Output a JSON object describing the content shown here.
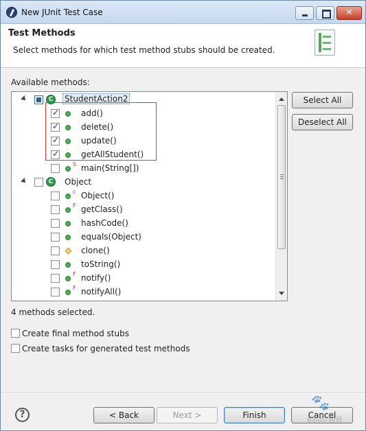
{
  "window": {
    "title": "New JUnit Test Case"
  },
  "header": {
    "title": "Test Methods",
    "description": "Select methods for which test method stubs should be created."
  },
  "available_label": "Available methods:",
  "tree": [
    {
      "label": "StudentAction2",
      "type": "class",
      "icon_letter": "C",
      "checked": "partial"
    },
    {
      "label": "add()",
      "type": "method",
      "checked": true
    },
    {
      "label": "delete()",
      "type": "method",
      "checked": true
    },
    {
      "label": "update()",
      "type": "method",
      "checked": true
    },
    {
      "label": "getAllStudent()",
      "type": "method",
      "checked": true
    },
    {
      "label": "main(String[])",
      "type": "method",
      "modifier": "S",
      "checked": false
    },
    {
      "label": "Object",
      "type": "class",
      "icon_letter": "C",
      "checked": false
    },
    {
      "label": "Object()",
      "type": "method",
      "modifier": "c",
      "checked": false
    },
    {
      "label": "getClass()",
      "type": "method",
      "modifier": "F",
      "checked": false
    },
    {
      "label": "hashCode()",
      "type": "method",
      "checked": false
    },
    {
      "label": "equals(Object)",
      "type": "method",
      "checked": false
    },
    {
      "label": "clone()",
      "type": "protected",
      "checked": false
    },
    {
      "label": "toString()",
      "type": "method",
      "checked": false
    },
    {
      "label": "notify()",
      "type": "method",
      "modifier": "F",
      "checked": false
    },
    {
      "label": "notifyAll()",
      "type": "method",
      "modifier": "F",
      "checked": false
    }
  ],
  "buttons": {
    "select_all": "Select All",
    "deselect_all": "Deselect All",
    "back": "< Back",
    "next": "Next >",
    "finish": "Finish",
    "cancel": "Cancel"
  },
  "status": "4 methods selected.",
  "options": {
    "final_stubs": "Create final method stubs",
    "tasks": "Create tasks for generated test methods"
  },
  "help": "?",
  "colors": {
    "method_green": "#4caf50",
    "highlight_red": "#e03a3a",
    "accent_blue": "#3c7fb1"
  },
  "watermark": {
    "icon": "paw-icon",
    "text": "Baidu 经验"
  }
}
